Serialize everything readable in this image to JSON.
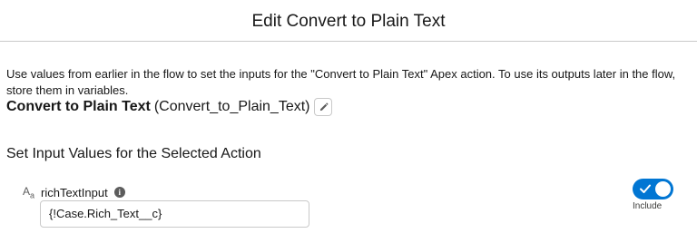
{
  "header": {
    "title": "Edit Convert to Plain Text"
  },
  "description": "Use values from earlier in the flow to set the inputs for the \"Convert to Plain Text\" Apex action. To use its outputs later in the flow, store them in variables.",
  "action": {
    "label": "Convert to Plain Text",
    "api_name": "(Convert_to_Plain_Text)",
    "edit_icon": "pencil-icon"
  },
  "section_title": "Set Input Values for the Selected Action",
  "input_field": {
    "type_icon": "text-type-icon",
    "type_glyph_a": "A",
    "type_glyph_b": "a",
    "label": "richTextInput",
    "info_icon": "info-icon",
    "info_glyph": "i",
    "value": "{!Case.Rich_Text__c}",
    "include_label": "Include",
    "include_enabled": true
  },
  "colors": {
    "accent": "#0176d3",
    "border": "#c9c9c9",
    "text": "#181818"
  }
}
